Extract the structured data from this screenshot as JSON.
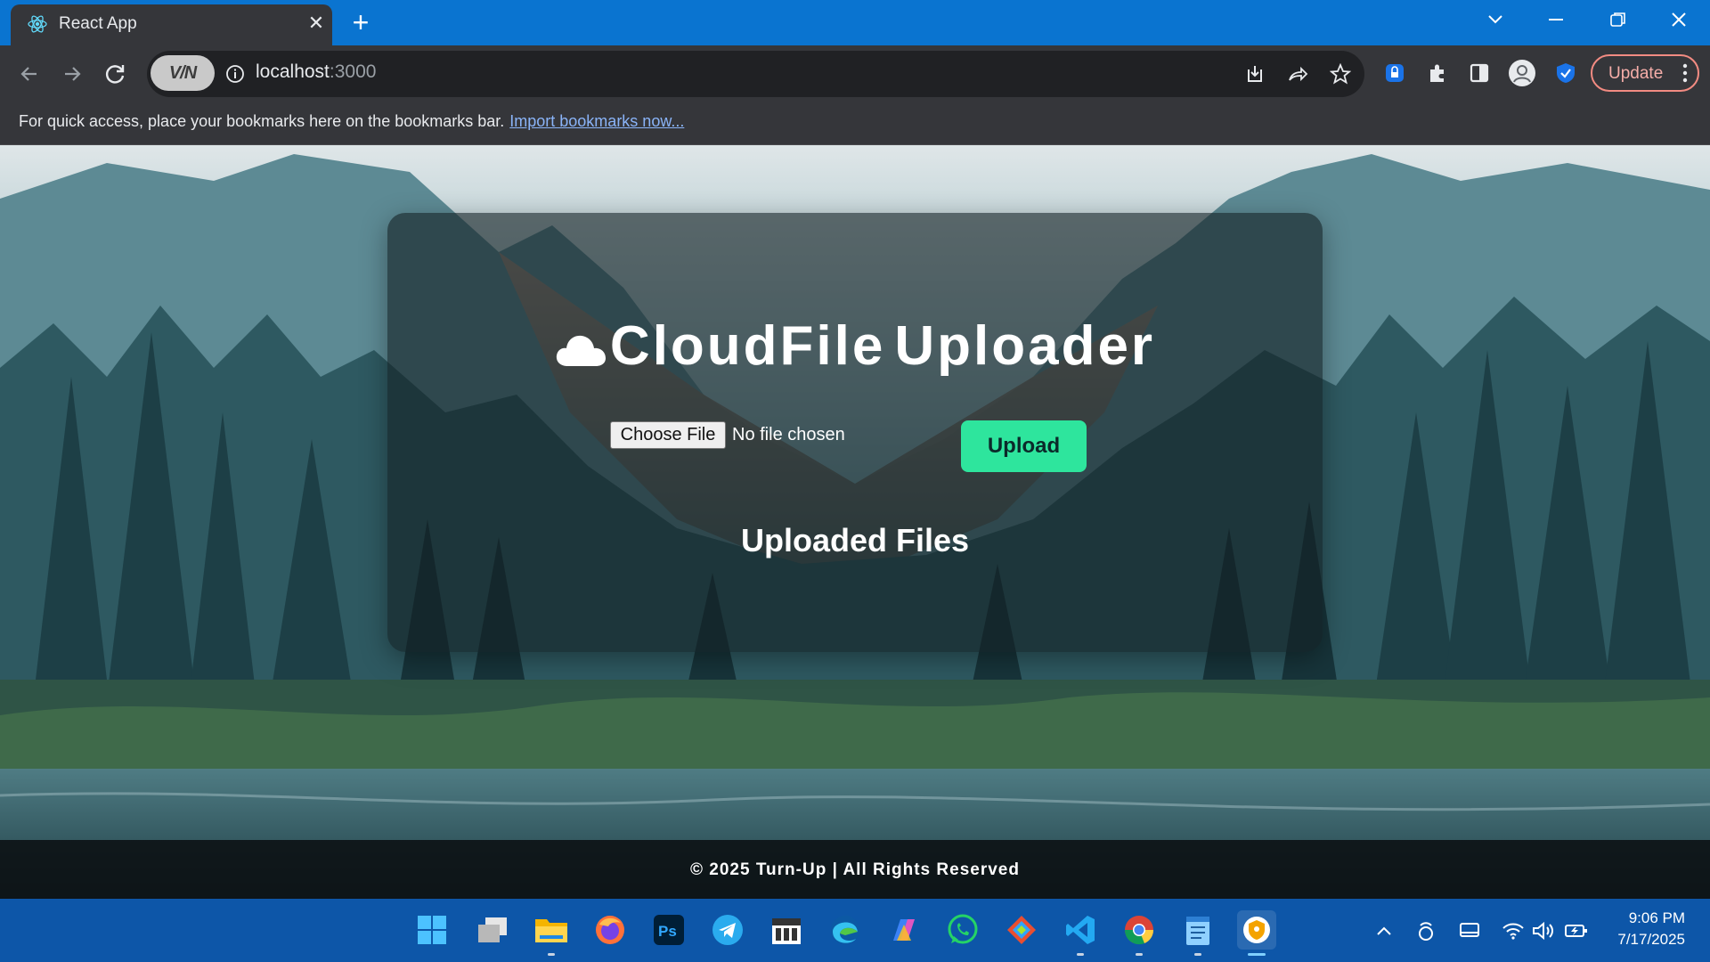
{
  "browser": {
    "tab_title": "React App",
    "url_host": "localhost",
    "url_port": ":3000",
    "vpn_label": "V/N",
    "update_label": "Update",
    "bookmarks_message": "For quick access, place your bookmarks here on the bookmarks bar.",
    "bookmarks_link": "Import bookmarks now..."
  },
  "app": {
    "title_words": [
      "CloudFile",
      "Uploader"
    ],
    "choose_file_label": "Choose File",
    "no_file_label": "No file chosen",
    "upload_label": "Upload",
    "uploaded_heading": "Uploaded Files",
    "footer": "© 2025 Turn-Up | All Rights Reserved"
  },
  "colors": {
    "tabstrip": "#0a74d0",
    "upload_button": "#2ee59d",
    "taskbar": "#0d56a8"
  },
  "taskbar": {
    "apps": [
      "windows-start-icon",
      "task-view-icon",
      "file-explorer-icon",
      "firefox-icon",
      "photoshop-icon",
      "telegram-icon",
      "calendar-app-icon",
      "edge-icon",
      "copilot-icon",
      "whatsapp-icon",
      "git-client-icon",
      "vscode-icon",
      "chrome-icon",
      "notepad-icon",
      "vpn-app-icon"
    ],
    "photoshop_label": "Ps",
    "time": "9:06 PM",
    "date": "7/17/2025"
  }
}
